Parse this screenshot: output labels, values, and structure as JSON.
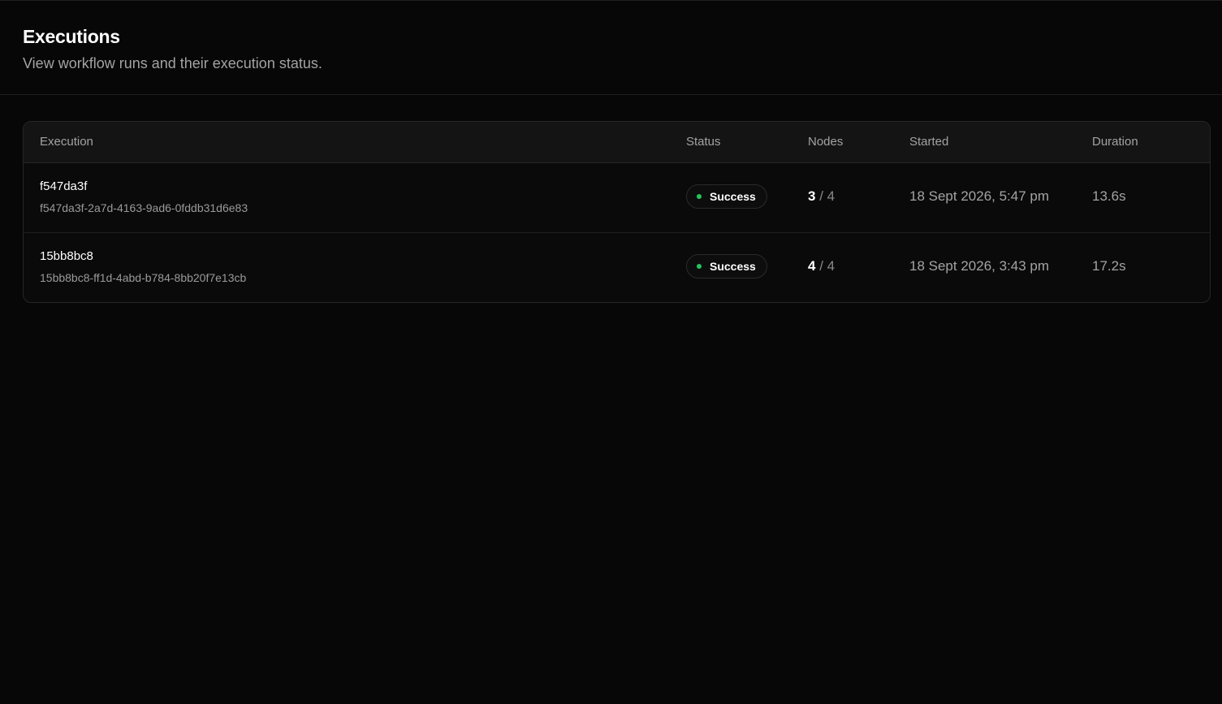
{
  "header": {
    "title": "Executions",
    "subtitle": "View workflow runs and their execution status."
  },
  "table": {
    "columns": {
      "execution": "Execution",
      "status": "Status",
      "nodes": "Nodes",
      "started": "Started",
      "duration": "Duration"
    },
    "rows": [
      {
        "short_id": "f547da3f",
        "full_id": "f547da3f-2a7d-4163-9ad6-0fddb31d6e83",
        "status": "Success",
        "nodes_done": "3",
        "nodes_sep": "/",
        "nodes_total": "4",
        "started": "18 Sept 2026, 5:47 pm",
        "duration": "13.6s"
      },
      {
        "short_id": "15bb8bc8",
        "full_id": "15bb8bc8-ff1d-4abd-b784-8bb20f7e13cb",
        "status": "Success",
        "nodes_done": "4",
        "nodes_sep": "/",
        "nodes_total": "4",
        "started": "18 Sept 2026, 3:43 pm",
        "duration": "17.2s"
      }
    ]
  },
  "colors": {
    "success_dot": "#22c55e",
    "background": "#070707"
  },
  "icons": {
    "status_indicator": "status-dot-icon"
  }
}
